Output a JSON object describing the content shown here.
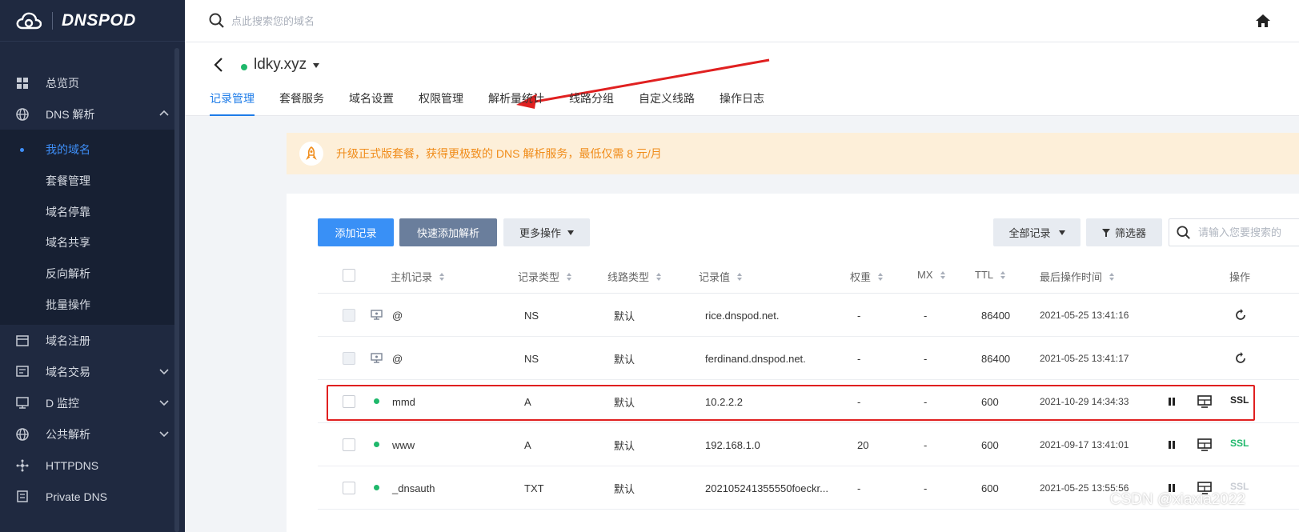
{
  "brand": {
    "name": "DNSPOD"
  },
  "sidebar": {
    "items": [
      {
        "label": "总览页",
        "icon": "grid-icon"
      },
      {
        "label": "DNS 解析",
        "icon": "globe-icon",
        "expanded": true
      }
    ],
    "dns_sub": [
      {
        "label": "我的域名",
        "active": true
      },
      {
        "label": "套餐管理"
      },
      {
        "label": "域名停靠"
      },
      {
        "label": "域名共享"
      },
      {
        "label": "反向解析"
      },
      {
        "label": "批量操作"
      }
    ],
    "items_after": [
      {
        "label": "域名注册",
        "icon": "calendar-icon"
      },
      {
        "label": "域名交易",
        "icon": "trade-icon",
        "chevron": true
      },
      {
        "label": "D 监控",
        "icon": "monitor-icon",
        "chevron": true
      },
      {
        "label": "公共解析",
        "icon": "globe-icon",
        "chevron": true
      },
      {
        "label": "HTTPDNS",
        "icon": "network-icon"
      },
      {
        "label": "Private DNS",
        "icon": "server-icon"
      }
    ]
  },
  "topbar": {
    "search_placeholder": "点此搜索您的域名"
  },
  "domain": {
    "name": "ldky.xyz",
    "status_color": "#1fb86b"
  },
  "tabs": [
    "记录管理",
    "套餐服务",
    "域名设置",
    "权限管理",
    "解析量统计",
    "线路分组",
    "自定义线路",
    "操作日志"
  ],
  "banner": {
    "text": "升级正式版套餐，获得更极致的 DNS 解析服务，最低仅需 8 元/月"
  },
  "toolbar": {
    "add": "添加记录",
    "quick_add": "快速添加解析",
    "more": "更多操作",
    "all_records": "全部记录",
    "filter": "筛选器",
    "search_placeholder": "请输入您要搜索的"
  },
  "table": {
    "headers": {
      "host": "主机记录",
      "type": "记录类型",
      "line": "线路类型",
      "value": "记录值",
      "weight": "权重",
      "mx": "MX",
      "ttl": "TTL",
      "time": "最后操作时间",
      "ops": "操作"
    },
    "rows": [
      {
        "host": "@",
        "type": "NS",
        "line": "默认",
        "value": "rice.dnspod.net.",
        "weight": "-",
        "mx": "-",
        "ttl": "86400",
        "time": "2021-05-25 13:41:16",
        "system": true
      },
      {
        "host": "@",
        "type": "NS",
        "line": "默认",
        "value": "ferdinand.dnspod.net.",
        "weight": "-",
        "mx": "-",
        "ttl": "86400",
        "time": "2021-05-25 13:41:17",
        "system": true
      },
      {
        "host": "mmd",
        "type": "A",
        "line": "默认",
        "value": "10.2.2.2",
        "weight": "-",
        "mx": "-",
        "ttl": "600",
        "time": "2021-10-29 14:34:33",
        "ssl": "SSL",
        "ssl_color": "#222222"
      },
      {
        "host": "www",
        "type": "A",
        "line": "默认",
        "value": "192.168.1.0",
        "weight": "20",
        "mx": "-",
        "ttl": "600",
        "time": "2021-09-17 13:41:01",
        "ssl": "SSL",
        "ssl_color": "#1fb86b"
      },
      {
        "host": "_dnsauth",
        "type": "TXT",
        "line": "默认",
        "value": "202105241355550foeckr...",
        "weight": "-",
        "mx": "-",
        "ttl": "600",
        "time": "2021-05-25 13:55:56",
        "ssl": "SSL",
        "ssl_color": "#c8ccd3"
      }
    ]
  },
  "watermark": "CSDN @xiaxia2022"
}
